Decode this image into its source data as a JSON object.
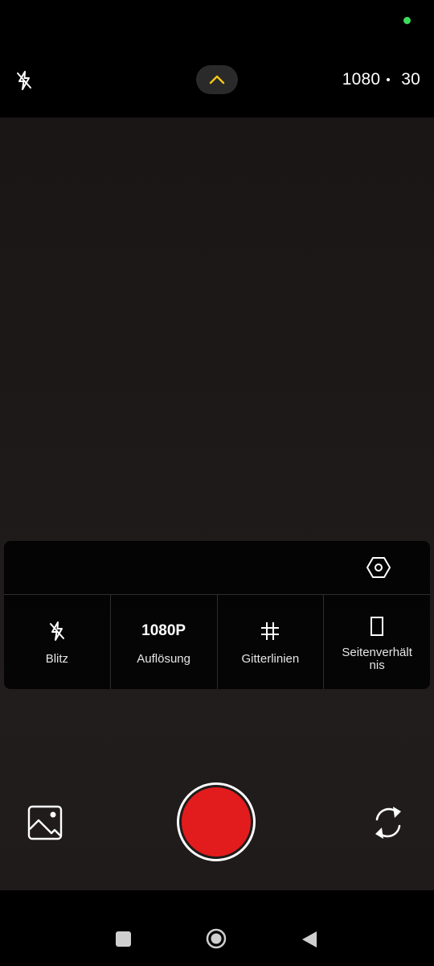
{
  "status_bar": {
    "indicator_color": "#3ddc5c"
  },
  "top_bar": {
    "flash_icon": "flash-off-icon",
    "expand_icon": "chevron-up-icon",
    "expand_icon_color": "#f5c518",
    "resolution": "1080",
    "fps": "30"
  },
  "settings_panel": {
    "settings_icon": "hexagon-settings-icon",
    "options": [
      {
        "icon": "flash-off-icon",
        "label": "Blitz"
      },
      {
        "value": "1080P",
        "label": "Auflösung"
      },
      {
        "icon": "grid-icon",
        "label": "Gitterlinien"
      },
      {
        "icon": "aspect-ratio-icon",
        "label": "Seitenverhältnis"
      }
    ]
  },
  "bottom_controls": {
    "gallery_icon": "gallery-icon",
    "record_color": "#e21c1c",
    "switch_icon": "switch-camera-icon"
  },
  "nav_bar": {
    "recents_icon": "recents-square-icon",
    "home_icon": "home-circle-icon",
    "back_icon": "back-triangle-icon",
    "icon_color": "#cfcfcf"
  }
}
